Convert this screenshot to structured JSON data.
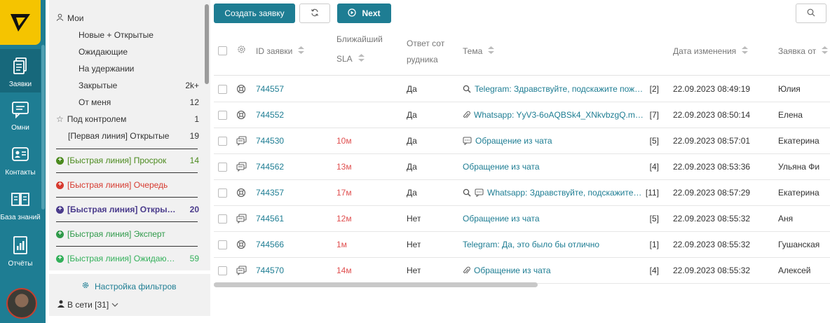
{
  "nav": {
    "items": [
      {
        "label": "Заявки",
        "icon": "tickets-icon"
      },
      {
        "label": "Омни",
        "icon": "chat-icon"
      },
      {
        "label": "Контакты",
        "icon": "contacts-icon"
      },
      {
        "label": "База знаний",
        "icon": "book-icon"
      },
      {
        "label": "Отчёты",
        "icon": "report-icon"
      }
    ]
  },
  "filters": {
    "my_label": "Мои",
    "my_items": [
      {
        "label": "Новые + Открытые",
        "count": ""
      },
      {
        "label": "Ожидающие",
        "count": ""
      },
      {
        "label": "На удержании",
        "count": ""
      },
      {
        "label": "Закрытые",
        "count": "2k+"
      },
      {
        "label": "От меня",
        "count": "12"
      }
    ],
    "control": {
      "label": "Под контролем",
      "count": "1"
    },
    "first_line": {
      "label": "[Первая линия] Открытые",
      "count": "19"
    },
    "fast": [
      {
        "label": "[Быстрая линия] Просрок",
        "count": "14",
        "color": "#4b8a1e"
      },
      {
        "label": "[Быстрая линия] Очередь",
        "count": "",
        "color": "#d63a2f"
      },
      {
        "label": "[Быстрая линия] Открыт…",
        "count": "20",
        "color": "#4a3b8c"
      },
      {
        "label": "[Быстрая линия] Эксперт",
        "count": "",
        "color": "#2f9a4a"
      },
      {
        "label": "[Быстрая линия] Ожидаю…",
        "count": "59",
        "color": "#33b05a"
      }
    ],
    "settings_label": "Настройка фильтров",
    "online_label": "В сети [31]"
  },
  "toolbar": {
    "create_label": "Создать заявку",
    "next_label": "Next"
  },
  "table": {
    "headers": {
      "id": "ID заявки",
      "sla_1": "Ближайший",
      "sla_2": "SLA",
      "reply_1": "Ответ сот",
      "reply_2": "рудника",
      "topic": "Тема",
      "changed": "Дата изменения",
      "from": "Заявка от"
    },
    "rows": [
      {
        "channel": "support-icon",
        "id": "744557",
        "sla": "",
        "reply": "Да",
        "icons": [
          "search-icon"
        ],
        "topic": "Telegram: Здравствуйте, подскажите пож…",
        "count": "[2]",
        "date": "22.09.2023 08:49:19",
        "from": "Юлия"
      },
      {
        "channel": "support-icon",
        "id": "744552",
        "sla": "",
        "reply": "Да",
        "icons": [
          "paperclip-icon"
        ],
        "topic": "Whatsapp: YyV3-6oAQBSk4_XNkvbzgQ.m…",
        "count": "[7]",
        "date": "22.09.2023 08:50:14",
        "from": "Елена"
      },
      {
        "channel": "chat-icon",
        "id": "744530",
        "sla": "10м",
        "reply": "Да",
        "icons": [
          "comment-icon"
        ],
        "topic": "Обращение из чата",
        "count": "[5]",
        "date": "22.09.2023 08:57:01",
        "from": "Екатерина"
      },
      {
        "channel": "chat-icon",
        "id": "744562",
        "sla": "13м",
        "reply": "Да",
        "icons": [],
        "topic": "Обращение из чата",
        "count": "[4]",
        "date": "22.09.2023 08:53:36",
        "from": "Ульяна Фи"
      },
      {
        "channel": "support-icon",
        "id": "744357",
        "sla": "17м",
        "reply": "Да",
        "icons": [
          "search-icon",
          "comment-icon"
        ],
        "topic": "Whatsapp: Здравствуйте, подскажите…",
        "count": "[11]",
        "date": "22.09.2023 08:57:29",
        "from": "Екатерина"
      },
      {
        "channel": "chat-icon",
        "id": "744561",
        "sla": "12м",
        "reply": "Нет",
        "icons": [],
        "topic": "Обращение из чата",
        "count": "[5]",
        "date": "22.09.2023 08:55:32",
        "from": "Аня"
      },
      {
        "channel": "support-icon",
        "id": "744566",
        "sla": "1м",
        "reply": "Нет",
        "icons": [],
        "topic": "Telegram: Да, это было бы отлично",
        "count": "[1]",
        "date": "22.09.2023 08:55:32",
        "from": "Гушанская"
      },
      {
        "channel": "chat-icon",
        "id": "744570",
        "sla": "14м",
        "reply": "Нет",
        "icons": [
          "paperclip-icon"
        ],
        "topic": "Обращение из чата",
        "count": "[4]",
        "date": "22.09.2023 08:55:32",
        "from": "Алексей"
      }
    ]
  },
  "colors": {
    "brand": "#1e7d93",
    "logo": "#f5c400",
    "sla": "#e05050"
  }
}
